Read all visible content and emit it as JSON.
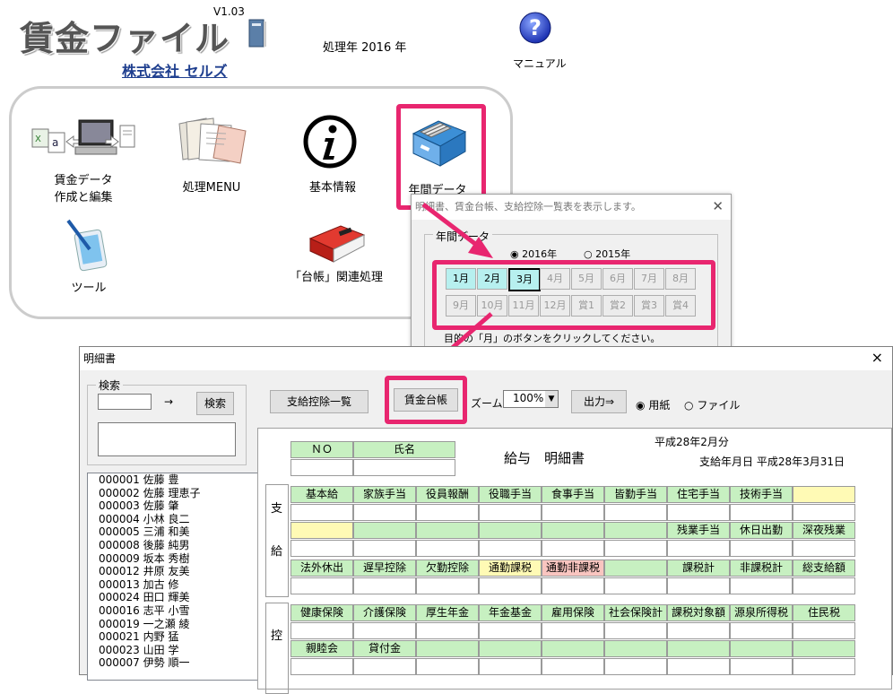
{
  "header": {
    "app_title": "賃金ファイル",
    "version": "V1.03",
    "company": "株式会社 セルズ",
    "year_label": "処理年 2016 年",
    "manual_label": "マニュアル"
  },
  "launcher": {
    "items": [
      {
        "label1": "賃金データ",
        "label2": "作成と編集"
      },
      {
        "label1": "処理MENU"
      },
      {
        "label1": "基本情報"
      },
      {
        "label1": "年間データ"
      },
      {
        "label1": "ツール"
      },
      {
        "label1": "「台帳」関連処理"
      }
    ]
  },
  "year_dialog": {
    "title": "明細書、賃金台帳、支給控除一覧表を表示します。",
    "group_label": "年間データ",
    "radio_2016": "2016年",
    "radio_2015": "2015年",
    "months_row1": [
      "1月",
      "2月",
      "3月",
      "4月",
      "5月",
      "6月",
      "7月",
      "8月"
    ],
    "months_row2": [
      "9月",
      "10月",
      "11月",
      "12月",
      "賞1",
      "賞2",
      "賞3",
      "賞4"
    ],
    "instruction": "目的の「月」のボタンをクリックしてください。"
  },
  "payslip": {
    "title": "明細書",
    "close": "×",
    "search_group": "検索",
    "arrow": "→",
    "search_button": "検索",
    "btn_list": "支給控除一覧",
    "btn_ledger": "賃金台帳",
    "zoom_label": "ズーム",
    "zoom_value": "100%",
    "btn_output": "出力⇒",
    "radio_paper": "用紙",
    "radio_file": "ファイル",
    "employees": [
      "000001 佐藤 豊",
      "000002 佐藤 理恵子",
      "000003 佐藤 肇",
      "000004 小林 良二",
      "000005 三浦 和美",
      "000008 後藤 純男",
      "000009 坂本 秀樹",
      "000012 井原 友美",
      "000013 加古 修",
      "000024 田口 輝美",
      "000016 志平 小雪",
      "000019 一之瀬 綾",
      "000021 内野 猛",
      "000023 山田 学",
      "000007 伊勢 順一"
    ],
    "form": {
      "no_header": "ＮＯ",
      "name_header": "氏名",
      "doc_title": "給与　明細書",
      "period": "平成28年2月分",
      "pay_date": "支給年月日 平成28年3月31日",
      "side_pay1": "支",
      "side_pay2": "給",
      "side_ded": "控",
      "row1": [
        "基本給",
        "家族手当",
        "役員報酬",
        "役職手当",
        "食事手当",
        "皆勤手当",
        "住宅手当",
        "技術手当",
        ""
      ],
      "row2": [
        "",
        "",
        "",
        "",
        "",
        "",
        "残業手当",
        "休日出勤",
        "深夜残業"
      ],
      "row3": [
        "法外休出",
        "遅早控除",
        "欠勤控除",
        "通勤課税",
        "通勤非課税",
        "",
        "課税計",
        "非課税計",
        "総支給額"
      ],
      "row4": [
        "健康保険",
        "介護保険",
        "厚生年金",
        "年金基金",
        "雇用保険",
        "社会保険計",
        "課税対象額",
        "源泉所得税",
        "住民税"
      ],
      "row5": [
        "親睦会",
        "貸付金",
        "",
        "",
        "",
        "",
        "",
        "",
        ""
      ]
    }
  }
}
